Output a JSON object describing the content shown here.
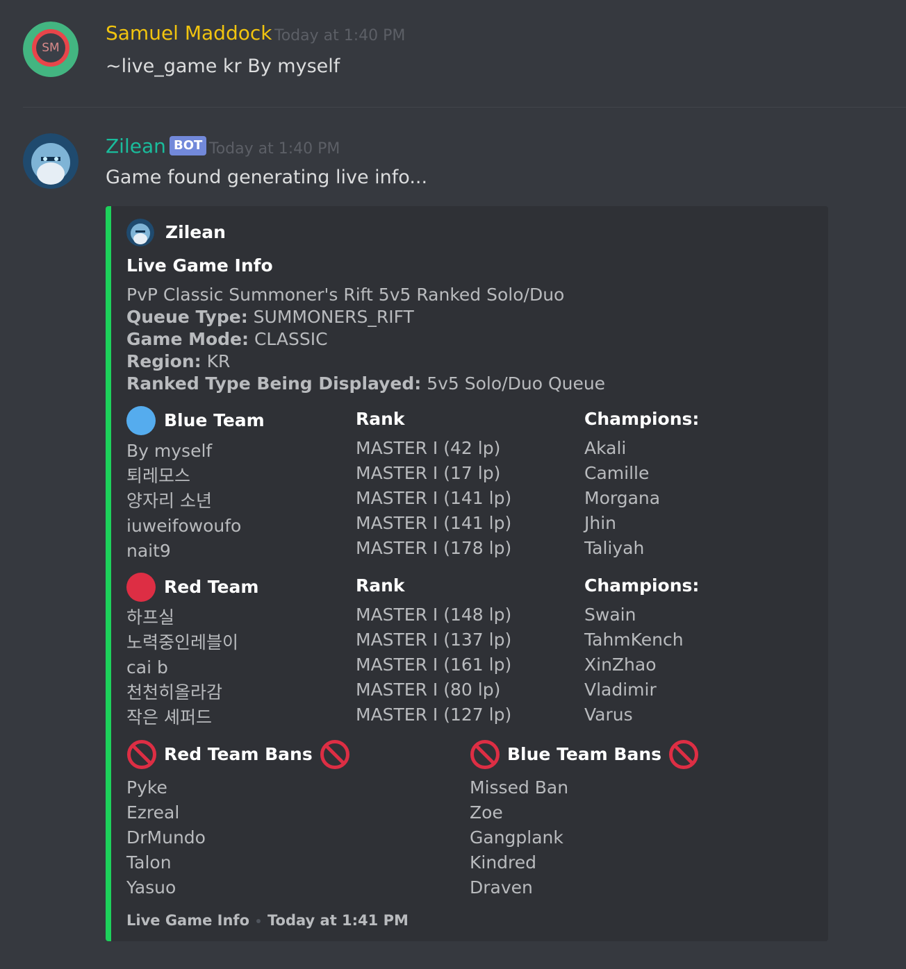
{
  "messages": [
    {
      "author": "Samuel Maddock",
      "author_color": "#f1c40f",
      "avatar_initials": "SM",
      "timestamp": "Today at 1:40 PM",
      "content": "~live_game kr By myself"
    },
    {
      "author": "Zilean",
      "author_color": "#1abc9c",
      "bot_tag": "BOT",
      "timestamp": "Today at 1:40 PM",
      "content": "Game found generating live info..."
    }
  ],
  "embed": {
    "accent_color": "#1dd15b",
    "author_name": "Zilean",
    "title": "Live Game Info",
    "description_line": "PvP Classic Summoner's Rift 5v5 Ranked Solo/Duo",
    "details": [
      {
        "label": "Queue Type:",
        "value": "SUMMONERS_RIFT"
      },
      {
        "label": "Game Mode:",
        "value": "CLASSIC"
      },
      {
        "label": "Region:",
        "value": "KR"
      },
      {
        "label": "Ranked Type Being Displayed:",
        "value": "5v5 Solo/Duo Queue"
      }
    ],
    "blue_team": {
      "title": "Blue Team",
      "color": "#55acee",
      "players": [
        "By myself",
        "퇴레모스",
        "양자리 소년",
        "iuweifowoufo",
        "nait9"
      ],
      "rank_title": "Rank",
      "ranks": [
        "MASTER I (42 lp)",
        "MASTER I (17 lp)",
        "MASTER I (141 lp)",
        "MASTER I (141 lp)",
        "MASTER I (178 lp)"
      ],
      "champions_title": "Champions:",
      "champions": [
        "Akali",
        "Camille",
        "Morgana",
        "Jhin",
        "Taliyah"
      ]
    },
    "red_team": {
      "title": "Red Team",
      "color": "#dd2e44",
      "players": [
        "하프실",
        "노력중인레블이",
        "cai b",
        "천천히올라감",
        "작은 셰퍼드"
      ],
      "rank_title": "Rank",
      "ranks": [
        "MASTER I (148 lp)",
        "MASTER I (137 lp)",
        "MASTER I (161 lp)",
        "MASTER I (80 lp)",
        "MASTER I (127 lp)"
      ],
      "champions_title": "Champions:",
      "champions": [
        "Swain",
        "TahmKench",
        "XinZhao",
        "Vladimir",
        "Varus"
      ]
    },
    "red_bans": {
      "title": "Red Team Bans",
      "icon": "no-entry-sign-icon",
      "bans": [
        "Pyke",
        "Ezreal",
        "DrMundo",
        "Talon",
        "Yasuo"
      ]
    },
    "blue_bans": {
      "title": "Blue Team Bans",
      "icon": "no-entry-sign-icon",
      "bans": [
        "Missed Ban",
        "Zoe",
        "Gangplank",
        "Kindred",
        "Draven"
      ]
    },
    "footer_text": "Live Game Info",
    "footer_timestamp": "Today at 1:41 PM"
  }
}
